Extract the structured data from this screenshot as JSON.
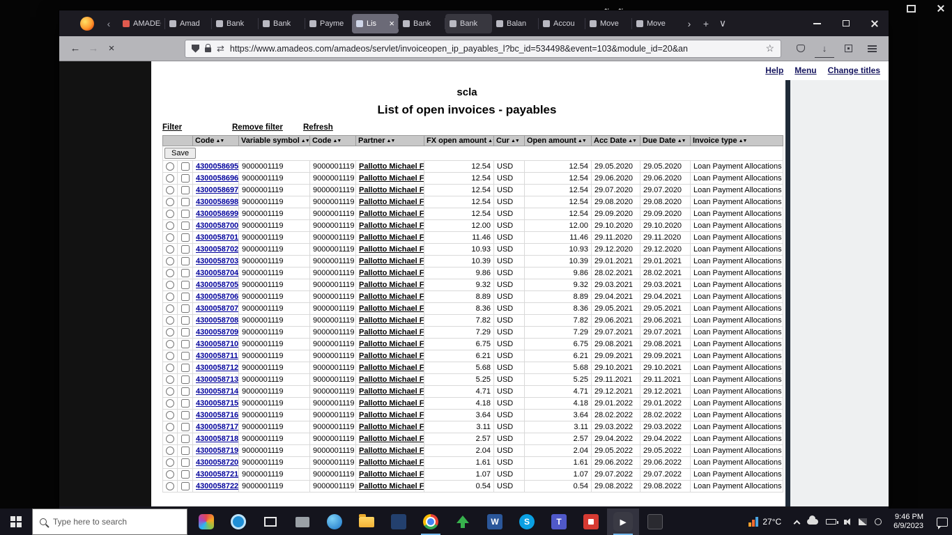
{
  "desktop": {
    "glyphs": {
      "sort": "⇅"
    }
  },
  "browser": {
    "tab_controls": {
      "scroll_left": "‹",
      "scroll_right": "›",
      "new_tab": "+",
      "list": "∨"
    },
    "tab_close_glyph": "×",
    "tabs": [
      {
        "label": "AMADEOS",
        "favicon": "#e05a4e"
      },
      {
        "label": "Amad",
        "favicon": "#b9b9c2"
      },
      {
        "label": "Bank",
        "favicon": "#b9b9c2"
      },
      {
        "label": "Bank",
        "favicon": "#b9b9c2"
      },
      {
        "label": "Payme",
        "favicon": "#b9b9c2"
      },
      {
        "label": "Lis",
        "favicon": "#cfd6e8",
        "active": true
      },
      {
        "label": "Bank",
        "favicon": "#b9b9c2"
      },
      {
        "label": "Bank",
        "favicon": "#b9b9c2",
        "highlight": true
      },
      {
        "label": "Balan",
        "favicon": "#b9b9c2"
      },
      {
        "label": "Accou",
        "favicon": "#b9b9c2"
      },
      {
        "label": "Move",
        "favicon": "#b9b9c2"
      },
      {
        "label": "Move",
        "favicon": "#b9b9c2"
      }
    ],
    "window_controls": [
      "minimize",
      "maximize",
      "close"
    ],
    "glyphs": {
      "back": "←",
      "forward": "→",
      "stop": "×",
      "permissions": "⇄",
      "bookmark_star": "☆",
      "download": "↓"
    },
    "url": "https://www.amadeos.com/amadeos/servlet/invoiceopen_ip_payables_l?bc_id=534498&event=103&module_id=20&an"
  },
  "page": {
    "header_links": [
      {
        "label": "Help"
      },
      {
        "label": "Menu"
      },
      {
        "label": "Change titles"
      }
    ],
    "title": "scla",
    "subtitle": "List of open invoices - payables",
    "toolbar": {
      "filter": "Filter",
      "remove_filter": "Remove filter",
      "refresh": "Refresh",
      "save": "Save"
    },
    "table": {
      "headers": [
        "Code",
        "Variable symbol",
        "Code",
        "Partner",
        "FX open amount",
        "Cur",
        "Open amount",
        "Acc Date",
        "Due Date",
        "Invoice type"
      ],
      "sort_icon": "▲▼",
      "rows": [
        [
          "4300058695",
          "9000001119",
          "9000001119",
          "Pallotto Michael F",
          "12.54",
          "USD",
          "12.54",
          "29.05.2020",
          "29.05.2020",
          "Loan Payment Allocations"
        ],
        [
          "4300058696",
          "9000001119",
          "9000001119",
          "Pallotto Michael F",
          "12.54",
          "USD",
          "12.54",
          "29.06.2020",
          "29.06.2020",
          "Loan Payment Allocations"
        ],
        [
          "4300058697",
          "9000001119",
          "9000001119",
          "Pallotto Michael F",
          "12.54",
          "USD",
          "12.54",
          "29.07.2020",
          "29.07.2020",
          "Loan Payment Allocations"
        ],
        [
          "4300058698",
          "9000001119",
          "9000001119",
          "Pallotto Michael F",
          "12.54",
          "USD",
          "12.54",
          "29.08.2020",
          "29.08.2020",
          "Loan Payment Allocations"
        ],
        [
          "4300058699",
          "9000001119",
          "9000001119",
          "Pallotto Michael F",
          "12.54",
          "USD",
          "12.54",
          "29.09.2020",
          "29.09.2020",
          "Loan Payment Allocations"
        ],
        [
          "4300058700",
          "9000001119",
          "9000001119",
          "Pallotto Michael F",
          "12.00",
          "USD",
          "12.00",
          "29.10.2020",
          "29.10.2020",
          "Loan Payment Allocations"
        ],
        [
          "4300058701",
          "9000001119",
          "9000001119",
          "Pallotto Michael F",
          "11.46",
          "USD",
          "11.46",
          "29.11.2020",
          "29.11.2020",
          "Loan Payment Allocations"
        ],
        [
          "4300058702",
          "9000001119",
          "9000001119",
          "Pallotto Michael F",
          "10.93",
          "USD",
          "10.93",
          "29.12.2020",
          "29.12.2020",
          "Loan Payment Allocations"
        ],
        [
          "4300058703",
          "9000001119",
          "9000001119",
          "Pallotto Michael F",
          "10.39",
          "USD",
          "10.39",
          "29.01.2021",
          "29.01.2021",
          "Loan Payment Allocations"
        ],
        [
          "4300058704",
          "9000001119",
          "9000001119",
          "Pallotto Michael F",
          "9.86",
          "USD",
          "9.86",
          "28.02.2021",
          "28.02.2021",
          "Loan Payment Allocations"
        ],
        [
          "4300058705",
          "9000001119",
          "9000001119",
          "Pallotto Michael F",
          "9.32",
          "USD",
          "9.32",
          "29.03.2021",
          "29.03.2021",
          "Loan Payment Allocations"
        ],
        [
          "4300058706",
          "9000001119",
          "9000001119",
          "Pallotto Michael F",
          "8.89",
          "USD",
          "8.89",
          "29.04.2021",
          "29.04.2021",
          "Loan Payment Allocations"
        ],
        [
          "4300058707",
          "9000001119",
          "9000001119",
          "Pallotto Michael F",
          "8.36",
          "USD",
          "8.36",
          "29.05.2021",
          "29.05.2021",
          "Loan Payment Allocations"
        ],
        [
          "4300058708",
          "9000001119",
          "9000001119",
          "Pallotto Michael F",
          "7.82",
          "USD",
          "7.82",
          "29.06.2021",
          "29.06.2021",
          "Loan Payment Allocations"
        ],
        [
          "4300058709",
          "9000001119",
          "9000001119",
          "Pallotto Michael F",
          "7.29",
          "USD",
          "7.29",
          "29.07.2021",
          "29.07.2021",
          "Loan Payment Allocations"
        ],
        [
          "4300058710",
          "9000001119",
          "9000001119",
          "Pallotto Michael F",
          "6.75",
          "USD",
          "6.75",
          "29.08.2021",
          "29.08.2021",
          "Loan Payment Allocations"
        ],
        [
          "4300058711",
          "9000001119",
          "9000001119",
          "Pallotto Michael F",
          "6.21",
          "USD",
          "6.21",
          "29.09.2021",
          "29.09.2021",
          "Loan Payment Allocations"
        ],
        [
          "4300058712",
          "9000001119",
          "9000001119",
          "Pallotto Michael F",
          "5.68",
          "USD",
          "5.68",
          "29.10.2021",
          "29.10.2021",
          "Loan Payment Allocations"
        ],
        [
          "4300058713",
          "9000001119",
          "9000001119",
          "Pallotto Michael F",
          "5.25",
          "USD",
          "5.25",
          "29.11.2021",
          "29.11.2021",
          "Loan Payment Allocations"
        ],
        [
          "4300058714",
          "9000001119",
          "9000001119",
          "Pallotto Michael F",
          "4.71",
          "USD",
          "4.71",
          "29.12.2021",
          "29.12.2021",
          "Loan Payment Allocations"
        ],
        [
          "4300058715",
          "9000001119",
          "9000001119",
          "Pallotto Michael F",
          "4.18",
          "USD",
          "4.18",
          "29.01.2022",
          "29.01.2022",
          "Loan Payment Allocations"
        ],
        [
          "4300058716",
          "9000001119",
          "9000001119",
          "Pallotto Michael F",
          "3.64",
          "USD",
          "3.64",
          "28.02.2022",
          "28.02.2022",
          "Loan Payment Allocations"
        ],
        [
          "4300058717",
          "9000001119",
          "9000001119",
          "Pallotto Michael F",
          "3.11",
          "USD",
          "3.11",
          "29.03.2022",
          "29.03.2022",
          "Loan Payment Allocations"
        ],
        [
          "4300058718",
          "9000001119",
          "9000001119",
          "Pallotto Michael F",
          "2.57",
          "USD",
          "2.57",
          "29.04.2022",
          "29.04.2022",
          "Loan Payment Allocations"
        ],
        [
          "4300058719",
          "9000001119",
          "9000001119",
          "Pallotto Michael F",
          "2.04",
          "USD",
          "2.04",
          "29.05.2022",
          "29.05.2022",
          "Loan Payment Allocations"
        ],
        [
          "4300058720",
          "9000001119",
          "9000001119",
          "Pallotto Michael F",
          "1.61",
          "USD",
          "1.61",
          "29.06.2022",
          "29.06.2022",
          "Loan Payment Allocations"
        ],
        [
          "4300058721",
          "9000001119",
          "9000001119",
          "Pallotto Michael F",
          "1.07",
          "USD",
          "1.07",
          "29.07.2022",
          "29.07.2022",
          "Loan Payment Allocations"
        ],
        [
          "4300058722",
          "9000001119",
          "9000001119",
          "Pallotto Michael F",
          "0.54",
          "USD",
          "0.54",
          "29.08.2022",
          "29.08.2022",
          "Loan Payment Allocations"
        ]
      ]
    }
  },
  "taskbar": {
    "search_placeholder": "Type here to search",
    "icons": [
      "paint",
      "cortana",
      "task-view",
      "project",
      "edge",
      "file-explorer",
      "dark-app",
      "chrome",
      "upload",
      "word",
      "skype",
      "teams",
      "red-app",
      "media-player",
      "dark-app-2"
    ],
    "icon_glyphs": {
      "word": "W",
      "skype": "S",
      "teams": "T",
      "media-player": "▶"
    },
    "weather": {
      "temp": "27°C"
    },
    "tray_icons": [
      "hidden-icons-chevron",
      "cloud",
      "battery",
      "speaker",
      "network",
      "circle"
    ],
    "clock": {
      "time": "9:46 PM",
      "date": "6/9/2023"
    }
  }
}
